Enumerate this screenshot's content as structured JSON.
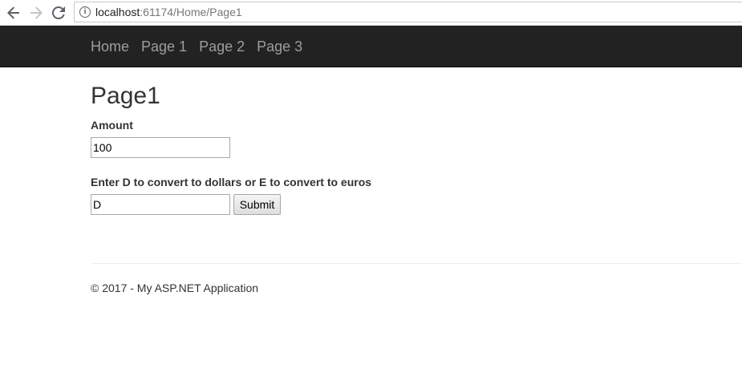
{
  "browser": {
    "url_host": "localhost",
    "url_rest": ":61174/Home/Page1"
  },
  "navbar": {
    "links": [
      {
        "label": "Home"
      },
      {
        "label": "Page 1"
      },
      {
        "label": "Page 2"
      },
      {
        "label": "Page 3"
      }
    ],
    "background": "#222222",
    "link_color": "#9d9d9d"
  },
  "main": {
    "title": "Page1",
    "amount": {
      "label": "Amount",
      "value": "100"
    },
    "convert": {
      "label": "Enter D to convert to dollars or E to convert to euros",
      "value": "D"
    },
    "submit_label": "Submit"
  },
  "footer": {
    "text": "© 2017 - My ASP.NET Application"
  }
}
